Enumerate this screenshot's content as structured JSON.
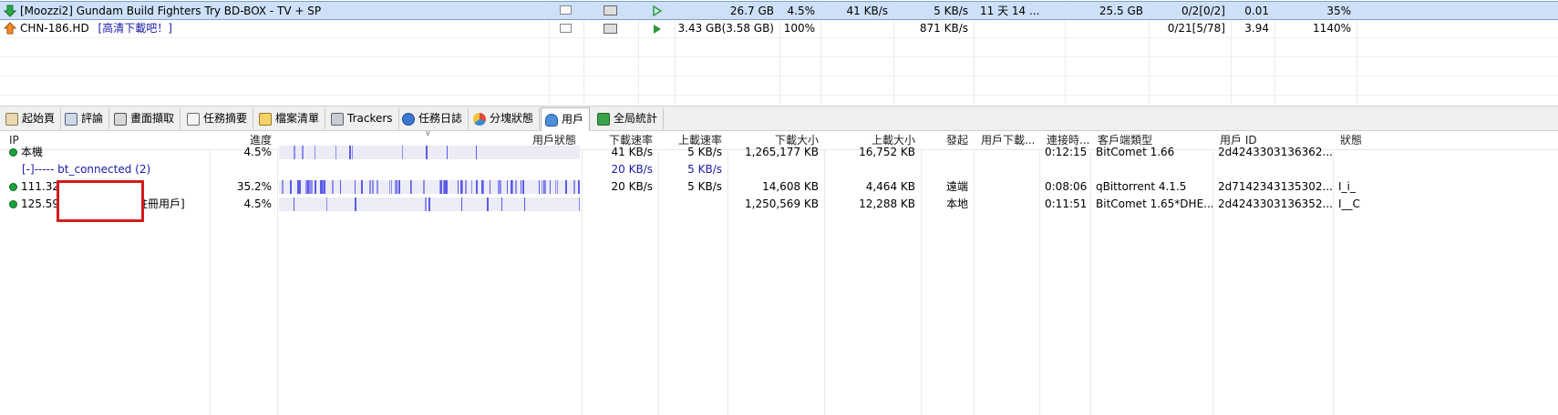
{
  "tasks": [
    {
      "name": "[Moozzi2] Gundam Build Fighters Try BD-BOX - TV + SP",
      "size": "26.7 GB",
      "progress": "4.5%",
      "down_speed": "41 KB/s",
      "up_speed": "5 KB/s",
      "eta": "11 天 14 ...",
      "remaining": "25.5 GB",
      "seeds": "0/2[0/2]",
      "ratio": "0.01",
      "health": "35%",
      "status_icon": "down-arrow-icon",
      "accent": "#1f9a3c"
    },
    {
      "name": "CHN-186.HD",
      "tag": "[高清下載吧！]",
      "size": "3.43 GB(3.58 GB)",
      "progress": "100%",
      "up_speed": "871 KB/s",
      "seeds": "0/21[5/78]",
      "ratio": "3.94",
      "health": "1140%",
      "status_icon": "up-arrow-icon",
      "accent": "#e8741a"
    }
  ],
  "tabs": [
    {
      "label": "起始頁",
      "icon": "home-icon"
    },
    {
      "label": "評論",
      "icon": "comment-icon"
    },
    {
      "label": "畫面擷取",
      "icon": "screenshot-icon"
    },
    {
      "label": "任務摘要",
      "icon": "summary-icon"
    },
    {
      "label": "檔案清單",
      "icon": "file-list-icon"
    },
    {
      "label": "Trackers",
      "icon": "trackers-icon"
    },
    {
      "label": "任務日誌",
      "icon": "info-icon"
    },
    {
      "label": "分塊狀態",
      "icon": "pie-icon"
    },
    {
      "label": "用戶",
      "icon": "user-icon"
    },
    {
      "label": "全局統計",
      "icon": "stats-icon"
    }
  ],
  "peer_columns": {
    "ip": "IP",
    "progress": "進度",
    "peer_state": "用戶狀態",
    "down_speed": "下載速率",
    "up_speed": "上載速率",
    "downloaded": "下載大小",
    "uploaded": "上載大小",
    "initiator": "發起",
    "peer_down": "用戶下載...",
    "connect_time": "連接時...",
    "client": "客戶端類型",
    "peer_id": "用戶 ID",
    "flags": "狀態"
  },
  "peers": [
    {
      "ip": "本機",
      "progress": "4.5%",
      "progress_fraction": 0.045,
      "down_speed": "41 KB/s",
      "up_speed": "5 KB/s",
      "downloaded": "1,265,177 KB",
      "uploaded": "16,752 KB",
      "connect_time": "0:12:15",
      "client": "BitComet 1.66",
      "peer_id": "2d4243303136362..."
    },
    {
      "group_label": "[-]----- bt_connected (2)",
      "down_speed": "20 KB/s",
      "up_speed": "5 KB/s"
    },
    {
      "ip": "111.32",
      "progress": "35.2%",
      "progress_fraction": 0.352,
      "down_speed": "20 KB/s",
      "up_speed": "5 KB/s",
      "downloaded": "14,608 KB",
      "uploaded": "4,464 KB",
      "initiator": "遠端",
      "connect_time": "0:08:06",
      "client": "qBittorrent 4.1.5",
      "peer_id": "2d7142343135302...",
      "flags": "I_i_"
    },
    {
      "ip": "125.59",
      "ip_suffix": "註冊用戶]",
      "progress": "4.5%",
      "progress_fraction": 0.045,
      "downloaded": "1,250,569 KB",
      "uploaded": "12,288 KB",
      "initiator": "本地",
      "connect_time": "0:11:51",
      "client": "BitComet 1.65*DHE...",
      "peer_id": "2d4243303136352...",
      "flags": "I__C"
    }
  ],
  "colors": {
    "selection": "#cde0f7",
    "link_blue": "#1a1aa6",
    "bar_blue": "#5a5ae6",
    "redact_border": "#d21c1c"
  }
}
